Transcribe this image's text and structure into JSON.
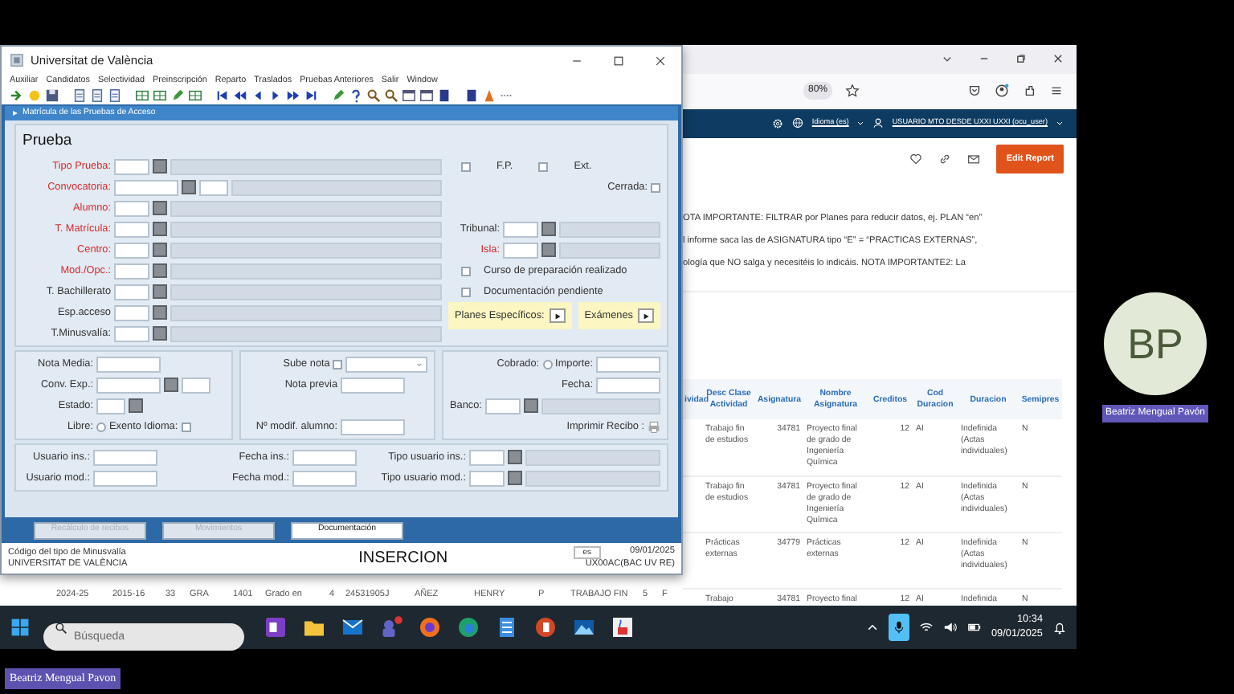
{
  "app_window": {
    "title": "Universitat de València",
    "menu": [
      "Auxiliar",
      "Candidatos",
      "Selectividad",
      "Preinscripción",
      "Reparto",
      "Traslados",
      "Pruebas Anteriores",
      "Salir",
      "Window"
    ],
    "form_title": "Matrícula de las Pruebas de Acceso",
    "section_title": "Prueba",
    "main_fields": [
      {
        "kind": "lov_desc",
        "label": "Tipo Prueba:",
        "required": true
      },
      {
        "kind": "lov_pair_desc",
        "label": "Convocatoria:",
        "required": true
      },
      {
        "kind": "lov_desc",
        "label": "Alumno:",
        "required": true
      },
      {
        "kind": "lov_desc",
        "label": "T. Matrícula:",
        "required": true
      },
      {
        "kind": "lov_desc",
        "label": "Centro:",
        "required": true
      },
      {
        "kind": "lov_desc",
        "label": "Mod./Opc.:",
        "required": true
      },
      {
        "kind": "lov_desc",
        "label": "T. Bachillerato",
        "required": false
      },
      {
        "kind": "lov_desc",
        "label": "Esp.acceso",
        "required": false
      },
      {
        "kind": "lov_desc",
        "label": "T.Minusvalía:",
        "required": false
      }
    ],
    "side_rows": [
      [
        {
          "kind": "checkbox",
          "label": "F.P.",
          "checked": false
        },
        {
          "kind": "checkbox",
          "label": "Ext.",
          "checked": false
        }
      ],
      [
        {
          "kind": "check_right",
          "label": "Cerrada:",
          "checked": false
        }
      ],
      [
        {
          "kind": "lov_desc",
          "label": "Tribunal:",
          "required": false
        }
      ],
      [
        {
          "kind": "lov_desc",
          "label": "Isla:",
          "required": true
        }
      ],
      [
        {
          "kind": "checkbox",
          "label": "Curso de preparación realizado",
          "checked": false
        }
      ],
      [
        {
          "kind": "checkbox",
          "label": "Documentación pendiente",
          "checked": false
        }
      ]
    ],
    "detail_buttons": [
      {
        "label": "Planes Específicos:"
      },
      {
        "label": "Exámenes"
      }
    ],
    "lower_panels": [
      [
        [
          {
            "kind": "field",
            "label": "Nota Media:"
          }
        ],
        [
          {
            "kind": "lov_pair",
            "label": "Conv. Exp.:"
          }
        ],
        [
          {
            "kind": "lov",
            "label": "Estado:"
          }
        ],
        [
          {
            "kind": "radio",
            "label": "Libre:",
            "checked": false
          },
          {
            "kind": "check_right",
            "label": "Exento Idioma:",
            "checked": false
          }
        ]
      ],
      [
        [
          {
            "kind": "check_right",
            "label": "Sube nota",
            "checked": false
          },
          {
            "kind": "select"
          }
        ],
        [
          {
            "kind": "field",
            "label": "Nota previa"
          }
        ],
        [
          {
            "kind": "field",
            "label": "Nº modif. alumno:"
          }
        ]
      ],
      [
        [
          {
            "kind": "radio",
            "label": "Cobrado:",
            "checked": false
          },
          {
            "kind": "field",
            "label": "Importe:"
          }
        ],
        [
          {
            "kind": "field",
            "label": "Fecha:"
          }
        ],
        [
          {
            "kind": "lov_desc",
            "label": "Banco:"
          }
        ],
        [
          {
            "kind": "print",
            "label": "Imprimir Recibo :"
          }
        ]
      ]
    ],
    "audit_rows": [
      [
        {
          "kind": "field",
          "label": "Usuario ins.:"
        },
        {
          "kind": "field",
          "label": "Fecha ins.:"
        },
        {
          "kind": "lov_desc",
          "label": "Tipo usuario ins.:"
        }
      ],
      [
        {
          "kind": "field",
          "label": "Usuario mod.:"
        },
        {
          "kind": "field",
          "label": "Fecha mod.:"
        },
        {
          "kind": "lov_desc",
          "label": "Tipo usuario mod.:"
        }
      ]
    ],
    "actions": [
      {
        "label": "Recálculo de recibos",
        "disabled": true
      },
      {
        "label": "Movimientos",
        "disabled": true
      },
      {
        "label": "Documentación",
        "disabled": false
      }
    ],
    "status": {
      "hint": "Código del tipo de Minusvalía",
      "organization": "UNIVERSITAT DE VALÈNCIA",
      "mode": "INSERCION",
      "language": "es",
      "date": "09/01/2025",
      "user": "UX00AC(BAC UV RE)"
    }
  },
  "browser": {
    "zoom": "80%",
    "header_links": [
      {
        "kind": "language",
        "label": "Idioma (es)"
      },
      {
        "kind": "user",
        "label": "USUARIO MTO DESDE UXXI UXXI (ocu_user)"
      }
    ],
    "edit_button": "Edit Report",
    "note_lines": [
      "OTA IMPORTANTE: FILTRAR por Planes para reducir datos, ej. PLAN “en”",
      "l informe saca las de ASIGNATURA tipo “E” = “PRACTICAS EXTERNAS”,",
      "ología que NO salga y necesitéis lo indicáis. NOTA IMPORTANTE2: La"
    ],
    "table": {
      "partial_column": "ividad",
      "columns": [
        "Desc Clase Actividad",
        "Asignatura",
        "Nombre Asignatura",
        "Creditos",
        "Cod Duracion",
        "Duracion",
        "Semipres"
      ],
      "rows": [
        [
          "Trabajo fin de estudios",
          "34781",
          "Proyecto final de grado de Ingeniería Química",
          "12",
          "AI",
          "Indefinida (Actas individuales)",
          "N"
        ],
        [
          "Trabajo fin de estudios",
          "34781",
          "Proyecto final de grado de Ingeniería Química",
          "12",
          "AI",
          "Indefinida (Actas individuales)",
          "N"
        ],
        [
          "Prácticas externas",
          "34779",
          "Prácticas externas",
          "12",
          "AI",
          "Indefinida (Actas individuales)",
          "N"
        ],
        [
          "Trabajo",
          "34781",
          "Proyecto final",
          "12",
          "AI",
          "Indefinida",
          "N"
        ]
      ]
    },
    "lower_row": [
      "2024-25",
      "2015-16",
      "33",
      "GRA",
      "1401",
      "Grado en",
      "4",
      "24531905J",
      "AÑEZ",
      "HENRY",
      "P",
      "TRABAJO FIN",
      "5",
      "F"
    ]
  },
  "taskbar": {
    "search_placeholder": "Búsqueda",
    "time": "10:34",
    "date": "09/01/2025"
  },
  "meeting": {
    "initials": "BP",
    "participant": "Beatriz Mengual Pavón",
    "presenter": "Beatriz Mengual Pavon"
  }
}
